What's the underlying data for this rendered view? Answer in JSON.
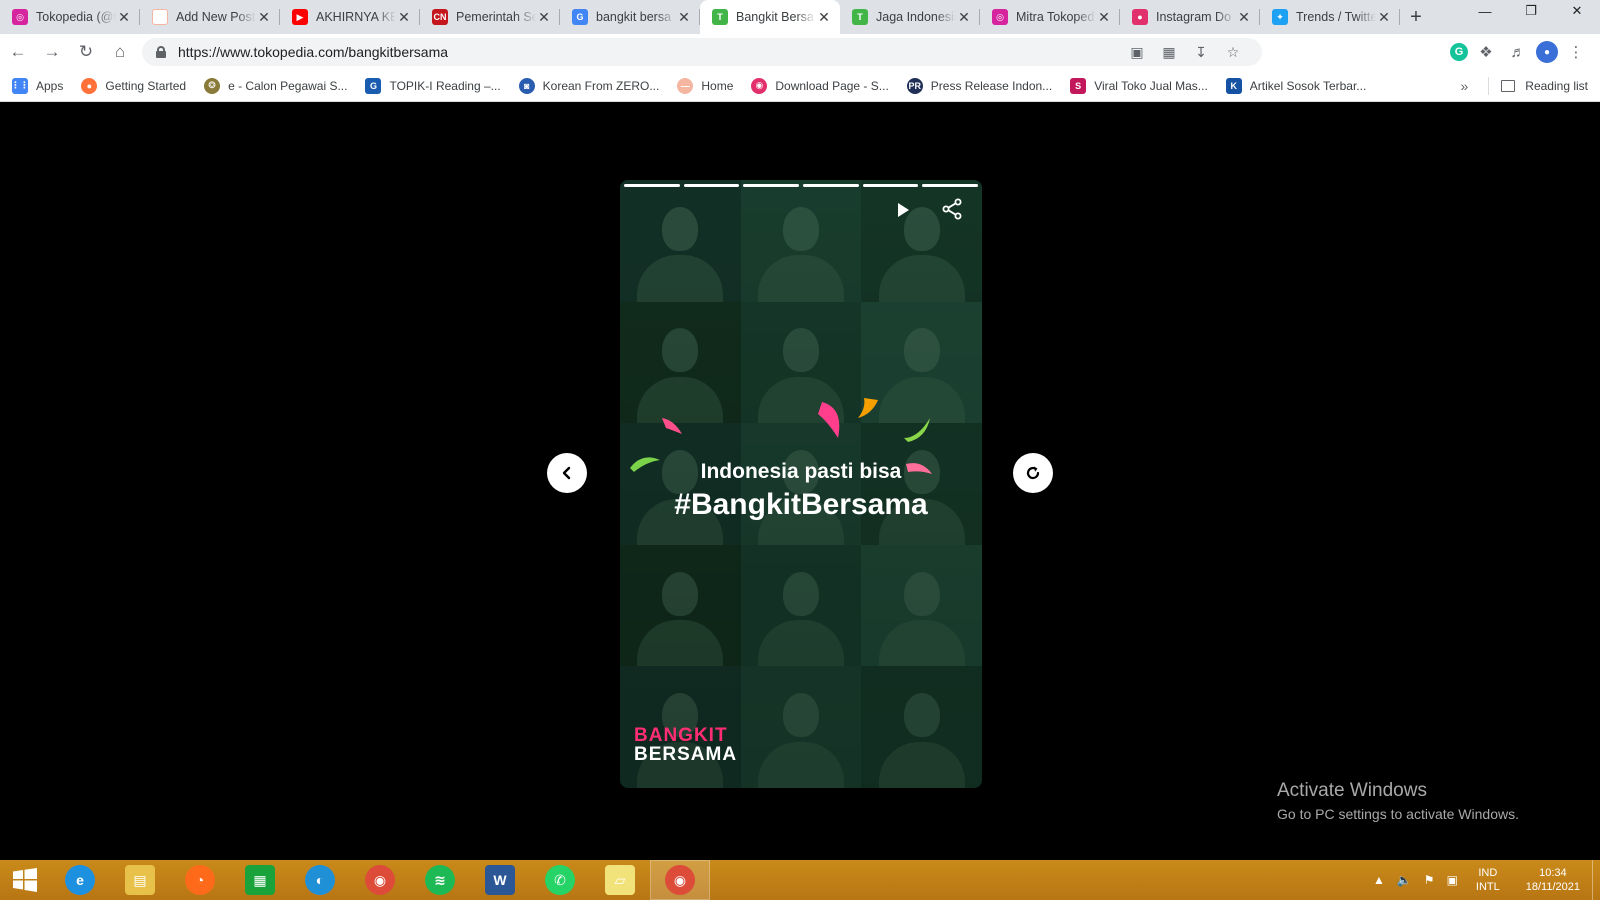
{
  "tabs": [
    {
      "title": "Tokopedia (@tokopedia)",
      "fav_color": "#d6249f",
      "fav_glyph": "◎"
    },
    {
      "title": "Add New Post",
      "fav_color": "#ffffff",
      "fav_glyph": ""
    },
    {
      "title": "AKHIRNYA KE",
      "fav_color": "#ff0000",
      "fav_glyph": "▶"
    },
    {
      "title": "Pemerintah Se",
      "fav_color": "#c4161c",
      "fav_glyph": "CN"
    },
    {
      "title": "bangkit bersa",
      "fav_color": "#4285f4",
      "fav_glyph": "G"
    },
    {
      "title": "Bangkit Bersa",
      "fav_color": "#42b549",
      "fav_glyph": "T",
      "active": true
    },
    {
      "title": "Jaga Indonesia",
      "fav_color": "#42b549",
      "fav_glyph": "T"
    },
    {
      "title": "Mitra Tokoped",
      "fav_color": "#d6249f",
      "fav_glyph": "◎"
    },
    {
      "title": "Instagram Do",
      "fav_color": "#e1306c",
      "fav_glyph": "●"
    },
    {
      "title": "Trends / Twitte",
      "fav_color": "#1da1f2",
      "fav_glyph": "✦"
    }
  ],
  "address": {
    "url": "https://www.tokopedia.com/bangkitbersama"
  },
  "bookmarks": [
    {
      "label": "Apps",
      "color": "#4285f4",
      "glyph": "⋮⋮"
    },
    {
      "label": "Getting Started",
      "color": "#ff7139",
      "glyph": "●"
    },
    {
      "label": "e - Calon Pegawai S...",
      "color": "#8a7a3a",
      "glyph": "❂"
    },
    {
      "label": "TOPIK-I Reading –...",
      "color": "#1a5cb0",
      "glyph": "G"
    },
    {
      "label": "Korean From ZERO...",
      "color": "#2a5db0",
      "glyph": "◙"
    },
    {
      "label": "Home",
      "color": "#f4b6a0",
      "glyph": "—"
    },
    {
      "label": "Download Page - S...",
      "color": "#e1306c",
      "glyph": "◉"
    },
    {
      "label": "Press Release Indon...",
      "color": "#1f2f56",
      "glyph": "PR"
    },
    {
      "label": "Viral Toko Jual Mas...",
      "color": "#c2185b",
      "glyph": "S"
    },
    {
      "label": "Artikel Sosok Terbar...",
      "color": "#1552a3",
      "glyph": "K"
    }
  ],
  "reading_list": "Reading list",
  "story": {
    "line1": "Indonesia pasti bisa",
    "line2": "#BangkitBersama",
    "logo_line1": "BANGKIT",
    "logo_line2": "BERSAMA",
    "progress": [
      1,
      1,
      1,
      1,
      1,
      1
    ]
  },
  "watermark": {
    "title": "Activate Windows",
    "subtitle": "Go to PC settings to activate Windows."
  },
  "taskbar": {
    "apps": [
      {
        "name": "internet-explorer",
        "color": "#1e90e0",
        "glyph": "e"
      },
      {
        "name": "file-explorer",
        "color": "#e8c14a",
        "glyph": "▤"
      },
      {
        "name": "firefox",
        "color": "#ff6a1a",
        "glyph": "◔"
      },
      {
        "name": "store",
        "color": "#1aa33a",
        "glyph": "▦"
      },
      {
        "name": "edge",
        "color": "#1f8fd6",
        "glyph": "◐"
      },
      {
        "name": "chrome",
        "color": "#dd4b39",
        "glyph": "◉"
      },
      {
        "name": "spotify",
        "color": "#1db954",
        "glyph": "≋"
      },
      {
        "name": "word",
        "color": "#2b5797",
        "glyph": "W"
      },
      {
        "name": "whatsapp",
        "color": "#25d366",
        "glyph": "✆"
      },
      {
        "name": "sticky-notes",
        "color": "#f2e27a",
        "glyph": "▱"
      },
      {
        "name": "chrome-active",
        "color": "#dd4b39",
        "glyph": "◉",
        "open": true
      }
    ],
    "lang_line1": "IND",
    "lang_line2": "INTL",
    "time": "10:34",
    "date": "18/11/2021"
  },
  "colors": {
    "accent_pink": "#ff2d74",
    "accent_green": "#42b549"
  }
}
